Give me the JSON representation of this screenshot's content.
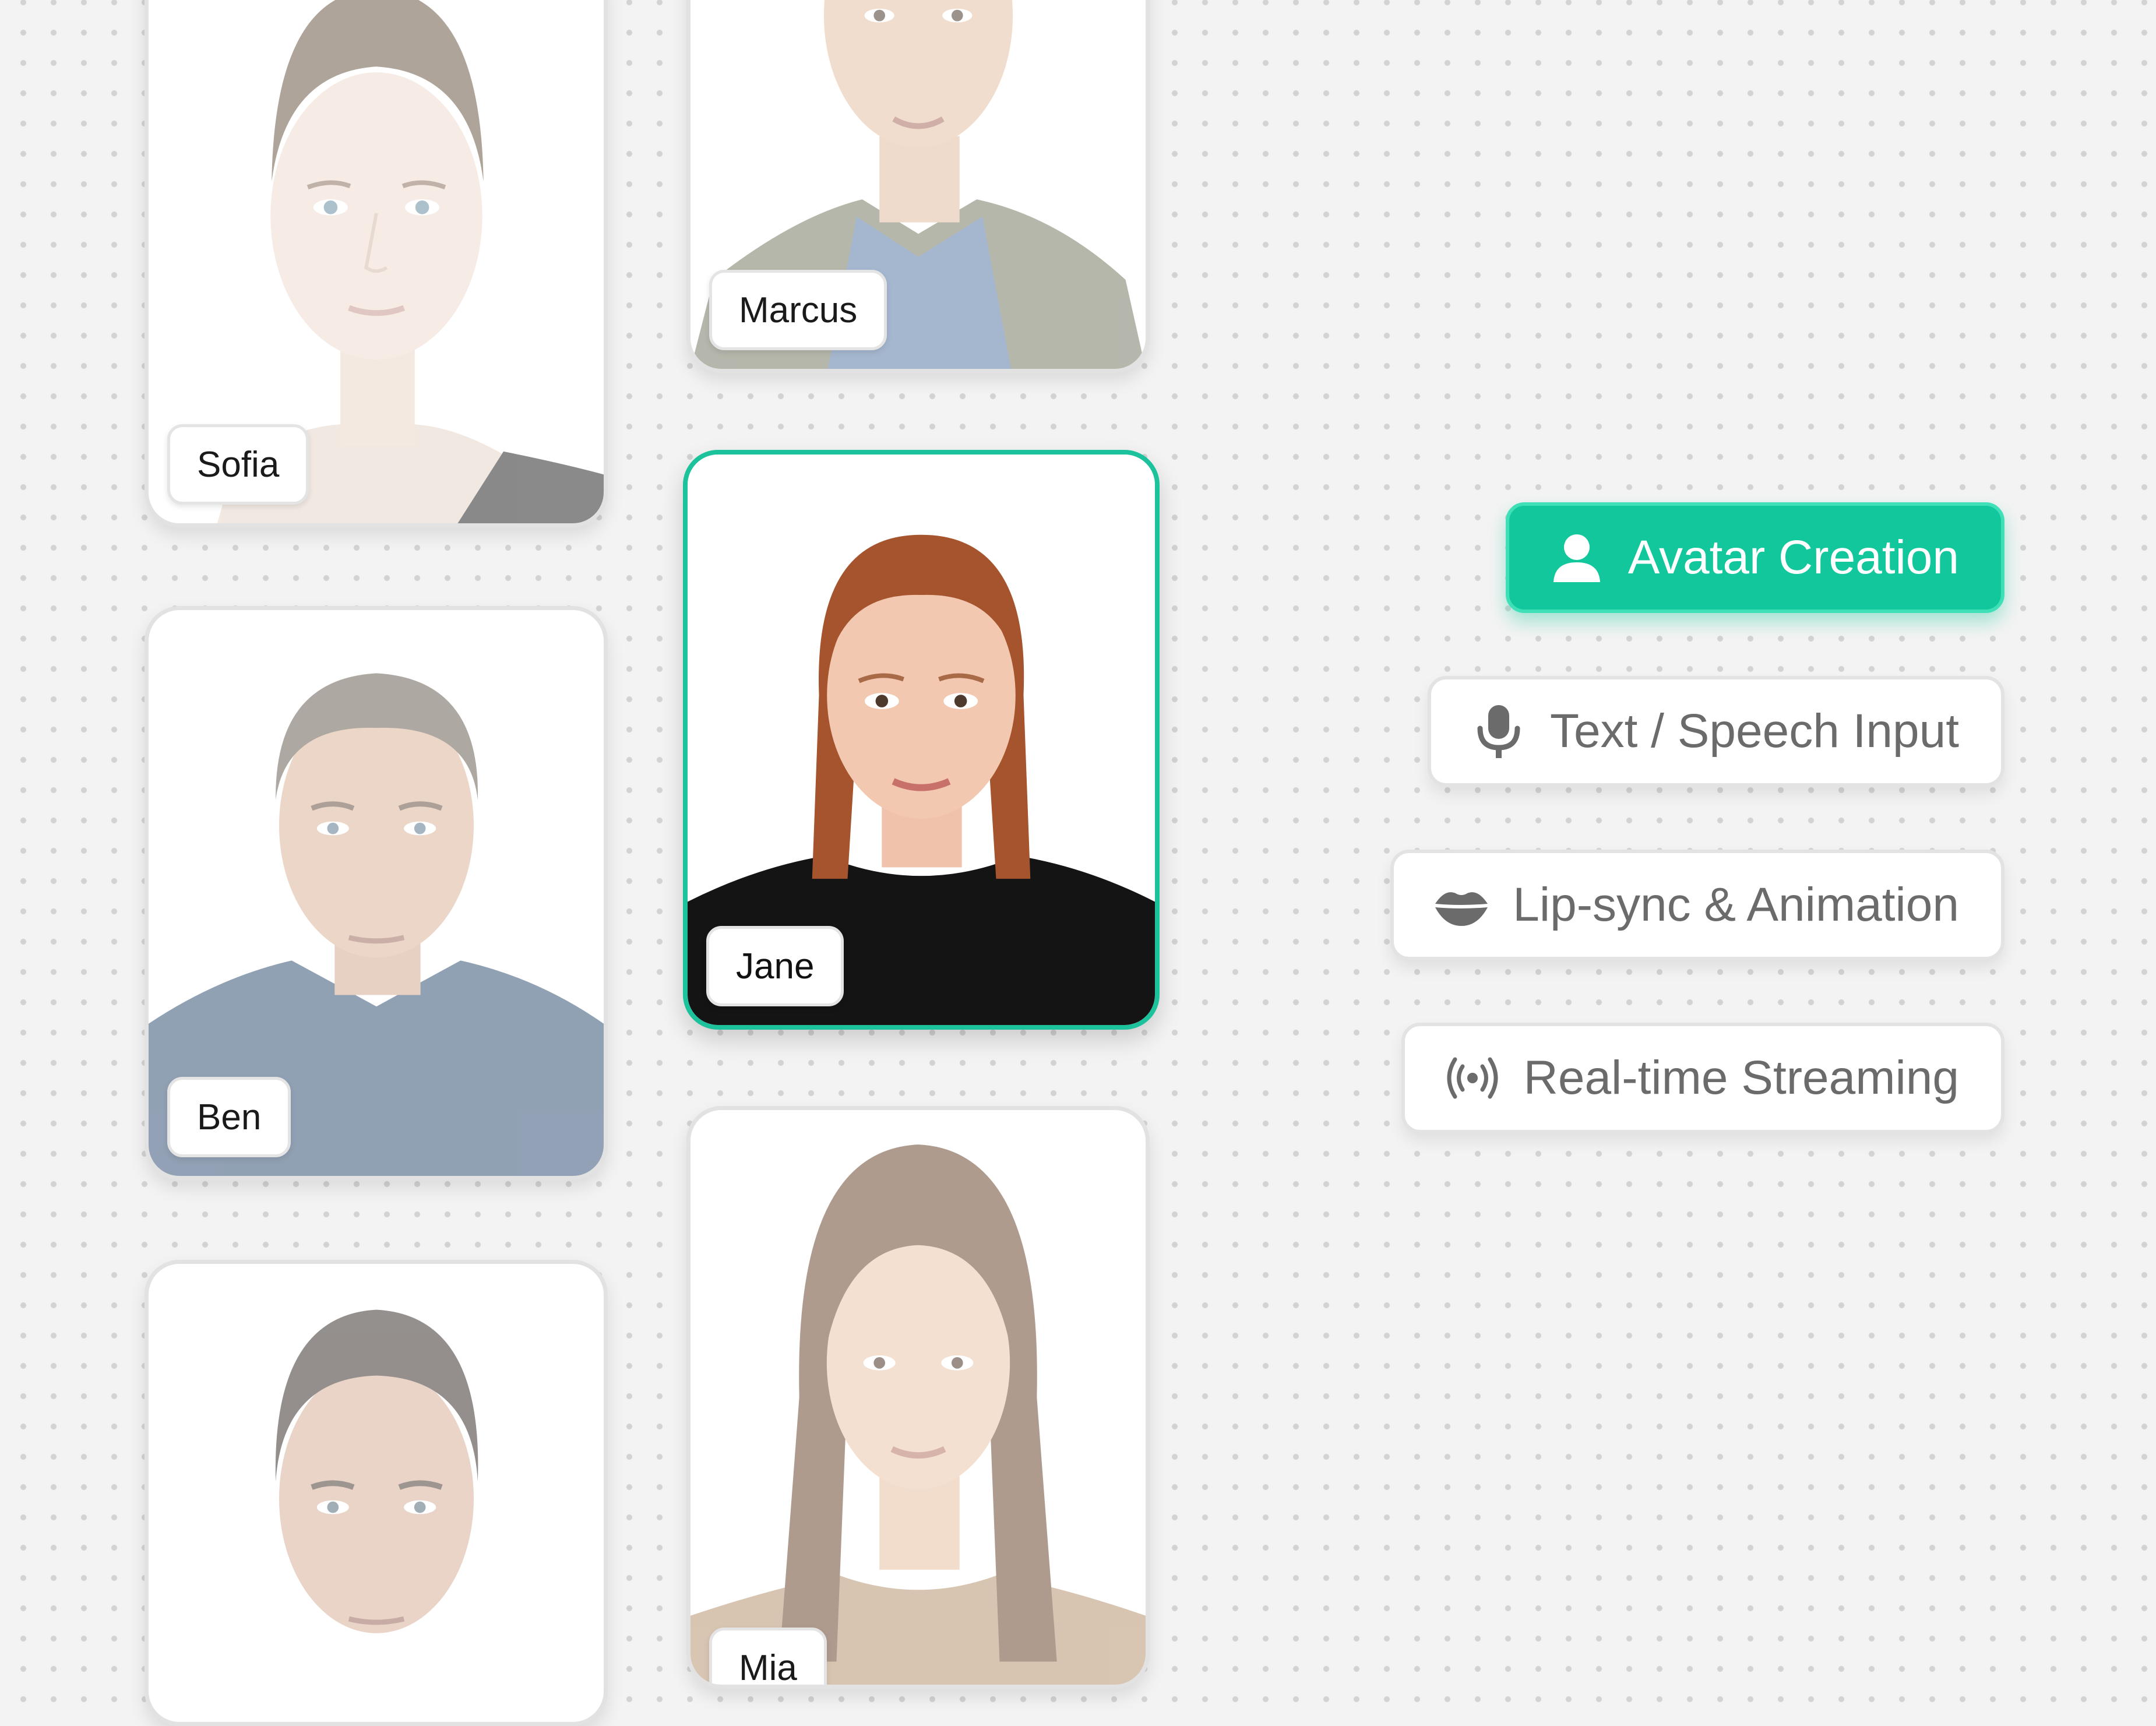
{
  "avatars": [
    {
      "name": "Sofia"
    },
    {
      "name": "Marcus"
    },
    {
      "name": "Ben"
    },
    {
      "name": "Jane"
    },
    {
      "name": ""
    },
    {
      "name": "Mia"
    }
  ],
  "features": [
    {
      "label": "Avatar Creation",
      "icon": "user-icon",
      "active": true
    },
    {
      "label": "Text / Speech Input",
      "icon": "microphone-icon",
      "active": false
    },
    {
      "label": "Lip-sync & Animation",
      "icon": "lips-icon",
      "active": false
    },
    {
      "label": "Real-time Streaming",
      "icon": "broadcast-icon",
      "active": false
    }
  ],
  "colors": {
    "accent": "#12c79c",
    "selected_border": "#1cc29c",
    "background": "#f3f3f3"
  }
}
